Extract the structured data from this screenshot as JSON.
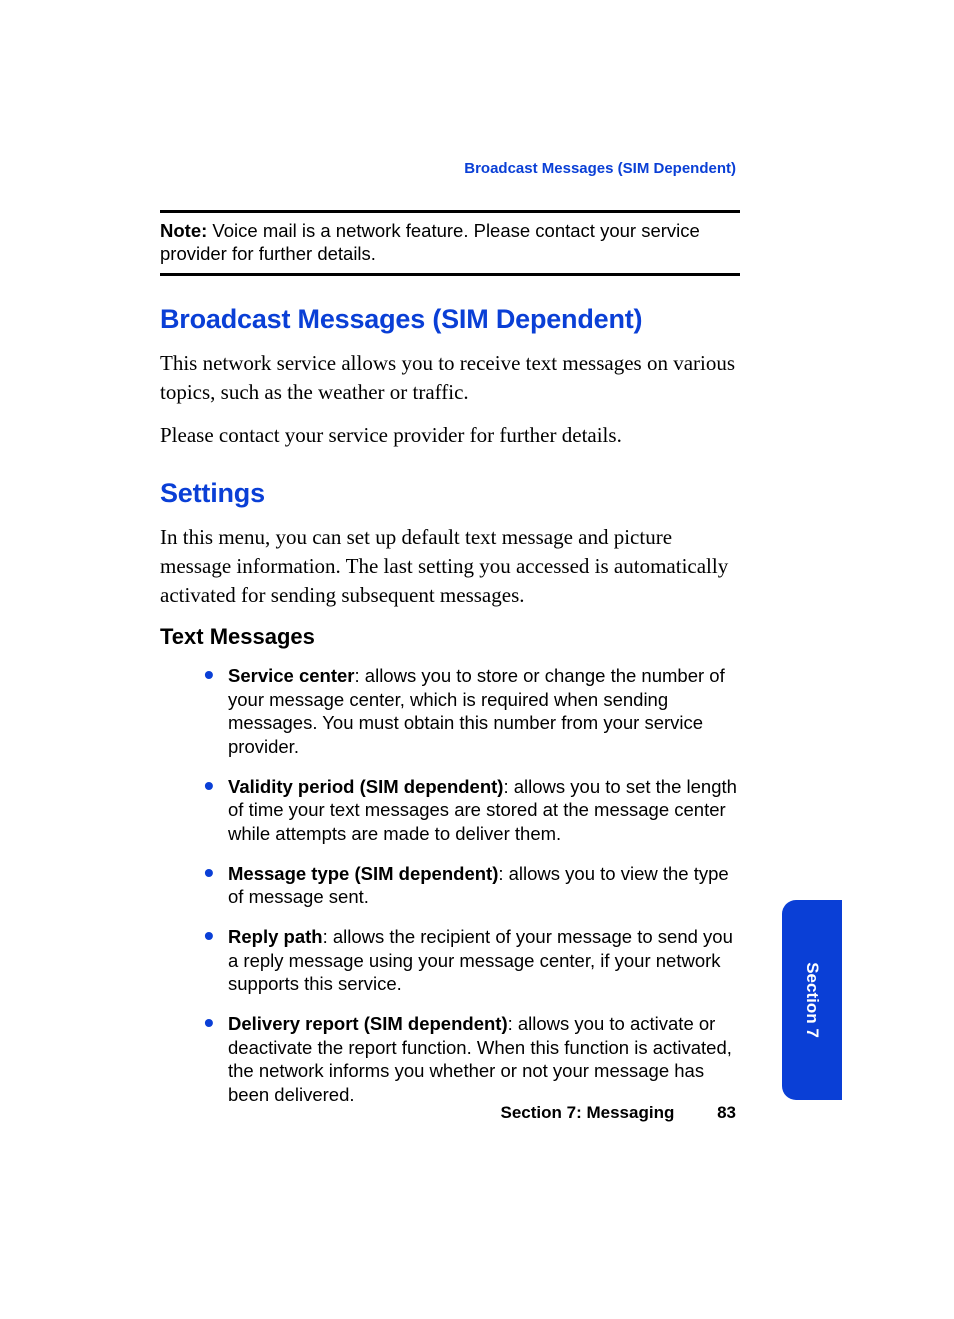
{
  "runningHeader": "Broadcast Messages (SIM Dependent)",
  "note": {
    "label": "Note:",
    "text": " Voice mail is a network feature. Please contact your service provider for further details."
  },
  "sections": {
    "broadcast": {
      "heading": "Broadcast Messages (SIM Dependent)",
      "p1": "This network service allows you to receive text messages on various topics, such as the weather or traffic.",
      "p2": "Please contact your service provider for further details."
    },
    "settings": {
      "heading": "Settings",
      "p1": "In this menu, you can set up default text message and picture message information. The last setting you accessed is automatically activated for sending subsequent messages.",
      "textMessages": {
        "heading": "Text Messages",
        "items": [
          {
            "term": "Service center",
            "desc": ": allows you to store or change the number of your message center, which is required when sending messages. You must obtain this number from your service provider."
          },
          {
            "term": "Validity period (SIM dependent)",
            "desc": ": allows you to set the length of time your text messages are stored at the message center while attempts are made to deliver them."
          },
          {
            "term": "Message type (SIM dependent)",
            "desc": ": allows you to view the type of message sent."
          },
          {
            "term": "Reply path",
            "desc": ": allows the recipient of your message to send you a reply message using your message center, if your network supports this service."
          },
          {
            "term": "Delivery report (SIM dependent)",
            "desc": ": allows you to activate or deactivate the report function. When this function is activated, the network informs you whether or not your message has been delivered."
          }
        ]
      }
    }
  },
  "footer": {
    "sectionLabel": "Section 7: Messaging",
    "pageNumber": "83"
  },
  "tab": {
    "label": "Section 7"
  }
}
